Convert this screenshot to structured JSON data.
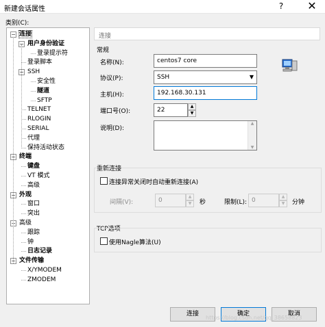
{
  "window": {
    "title": "新建会话属性",
    "help_glyph": "?",
    "close_glyph": "✕"
  },
  "category_label": "类别(C):",
  "tree": {
    "items": [
      {
        "label": "连接",
        "bold": true,
        "level": 0,
        "expander": "−"
      },
      {
        "label": "用户身份验证",
        "bold": true,
        "level": 1,
        "expander": "−"
      },
      {
        "label": "登录提示符",
        "bold": false,
        "level": 2
      },
      {
        "label": "登录脚本",
        "bold": false,
        "level": 1
      },
      {
        "label": "SSH",
        "bold": false,
        "level": 1,
        "expander": "−"
      },
      {
        "label": "安全性",
        "bold": false,
        "level": 2
      },
      {
        "label": "隧道",
        "bold": true,
        "level": 2
      },
      {
        "label": "SFTP",
        "bold": false,
        "level": 2
      },
      {
        "label": "TELNET",
        "bold": false,
        "level": 1
      },
      {
        "label": "RLOGIN",
        "bold": false,
        "level": 1
      },
      {
        "label": "SERIAL",
        "bold": false,
        "level": 1
      },
      {
        "label": "代理",
        "bold": false,
        "level": 1
      },
      {
        "label": "保持活动状态",
        "bold": false,
        "level": 1
      },
      {
        "label": "终端",
        "bold": true,
        "level": 0,
        "expander": "−"
      },
      {
        "label": "键盘",
        "bold": true,
        "level": 1
      },
      {
        "label": "VT 模式",
        "bold": false,
        "level": 1
      },
      {
        "label": "高级",
        "bold": false,
        "level": 1
      },
      {
        "label": "外观",
        "bold": true,
        "level": 0,
        "expander": "−"
      },
      {
        "label": "窗口",
        "bold": false,
        "level": 1
      },
      {
        "label": "突出",
        "bold": false,
        "level": 1
      },
      {
        "label": "高级",
        "bold": false,
        "level": 0,
        "expander": "−"
      },
      {
        "label": "跟踪",
        "bold": false,
        "level": 1
      },
      {
        "label": "钟",
        "bold": false,
        "level": 1
      },
      {
        "label": "日志记录",
        "bold": true,
        "level": 1
      },
      {
        "label": "文件传输",
        "bold": true,
        "level": 0,
        "expander": "−"
      },
      {
        "label": "X/YMODEM",
        "bold": false,
        "level": 1
      },
      {
        "label": "ZMODEM",
        "bold": false,
        "level": 1
      }
    ]
  },
  "breadcrumb": "连接",
  "general": {
    "title": "常规",
    "name_label": "名称(N):",
    "name_value": "centos7 core",
    "protocol_label": "协议(P):",
    "protocol_value": "SSH",
    "host_label": "主机(H):",
    "host_value": "192.168.30.131",
    "port_label": "端口号(O):",
    "port_value": "22",
    "desc_label": "说明(D):",
    "desc_value": ""
  },
  "reconnect": {
    "title": "重新连接",
    "checkbox_label": "连接异常关闭时自动重新连接(A)",
    "checked": false,
    "interval_label": "间隔(V):",
    "interval_value": "0",
    "interval_unit": "秒",
    "limit_label": "限制(L):",
    "limit_value": "0",
    "limit_unit": "分钟"
  },
  "tcp": {
    "title": "TCP选项",
    "nagle_label": "使用Nagle算法(U)",
    "checked": false
  },
  "buttons": {
    "connect": "连接",
    "ok": "确定",
    "cancel": "取消"
  },
  "watermark": "https://blog.csdn.net/qq_38658823"
}
